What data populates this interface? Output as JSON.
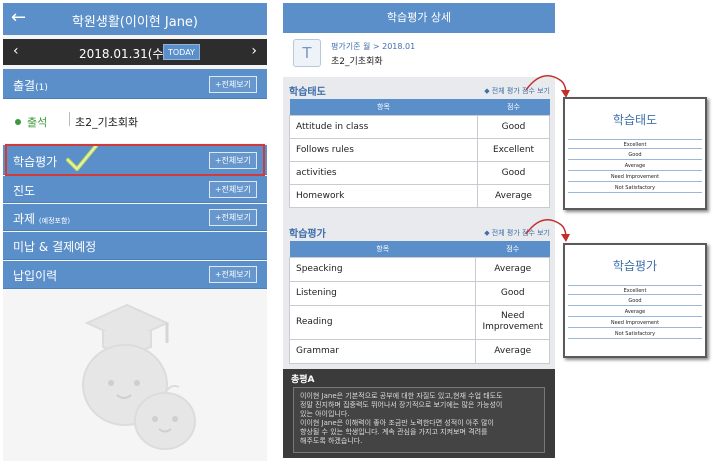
{
  "left": {
    "title": "학원생활(이이현 Jane)",
    "date": "2018.01.31(수)",
    "today": "TODAY",
    "attendance": {
      "label": "출결",
      "count": "(1)",
      "more": "+전체보기"
    },
    "status": "출석",
    "class_name": "초2_기초회화",
    "sections": [
      {
        "label": "학습평가",
        "more": "+전체보기"
      },
      {
        "label": "진도",
        "more": "+전체보기"
      },
      {
        "label": "과제",
        "sub": "(예정포함)",
        "more": "+전체보기"
      },
      {
        "label": "미납 & 결제예정"
      },
      {
        "label": "납입이력",
        "more": "+전체보기"
      }
    ]
  },
  "right": {
    "title": "학습평가 상세",
    "period": "평가기준 월 > 2018.01",
    "class_name": "초2_기초회화",
    "attitude": {
      "title": "학습태도",
      "link": "전체 평가 점수 보기",
      "h_item": "항목",
      "h_score": "점수",
      "rows": [
        [
          "Attitude in class",
          "Good"
        ],
        [
          "Follows rules",
          "Excellent"
        ],
        [
          "activities",
          "Good"
        ],
        [
          "Homework",
          "Average"
        ]
      ]
    },
    "evaluation": {
      "title": "학습평가",
      "link": "전체 평가 점수 보기",
      "h_item": "항목",
      "h_score": "점수",
      "rows": [
        [
          "Speacking",
          "Average"
        ],
        [
          "Listening",
          "Good"
        ],
        [
          "Reading",
          "Need Improvement"
        ],
        [
          "Grammar",
          "Average"
        ]
      ]
    },
    "summary": {
      "title": "총평A",
      "lines": [
        "이이현 Jane은 기본적으로 공부에 대한 자질도 있고,현재 수업 태도도",
        "정말 진지하며 집중력도 뛰어나서 장기적으로 보기에는 많은 가능성이",
        "있는 아이입니다.",
        "이이현 Jane은 이해력이 좋아 조금만 노력한다면 성적이 아주 많이",
        "향상될 수 있는 학생입니다. 계속 관심을 가지고 지켜보며 격려를",
        "해주도록 하겠습니다."
      ]
    }
  },
  "popups": [
    {
      "title": "학습태도",
      "scale": [
        "Excellent",
        "Good",
        "Average",
        "Need Improvement",
        "Not Satisfactory"
      ]
    },
    {
      "title": "학습평가",
      "scale": [
        "Excellent",
        "Good",
        "Average",
        "Need Improvement",
        "Not Satisfactory"
      ]
    }
  ]
}
